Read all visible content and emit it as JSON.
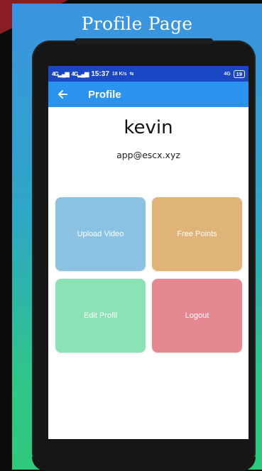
{
  "banner": {
    "title": "Profile Page"
  },
  "status_bar": {
    "network_1": "4G",
    "network_2": "4G",
    "time": "15:37",
    "speed": "18 K/s",
    "right_network": "4G",
    "battery": "19"
  },
  "app_bar": {
    "title": "Profile"
  },
  "profile": {
    "name": "kevin",
    "email": "app@escx.xyz"
  },
  "tiles": [
    {
      "label": "Upload Video",
      "color": "#8bc2e1"
    },
    {
      "label": "Free Points",
      "color": "#e0b478"
    },
    {
      "label": "Edit Profil",
      "color": "#8be2b4"
    },
    {
      "label": "Logout",
      "color": "#e58892"
    }
  ],
  "colors": {
    "status_bar": "#1c47c4",
    "app_bar": "#2a93ef",
    "banner_top": "#3b93e0",
    "banner_bottom": "#2ec97b"
  }
}
